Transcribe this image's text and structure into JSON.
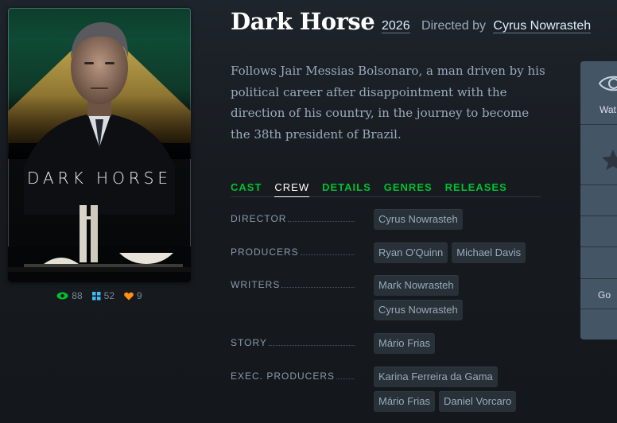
{
  "film": {
    "title": "Dark Horse",
    "year": "2026",
    "directed_by_label": "Directed by",
    "director": "Cyrus Nowrasteh",
    "synopsis": "Follows Jair Messias Bolsonaro, a man driven by his political career after disappointment with the direction of his country, in the journey to become the 38th president of Brazil."
  },
  "poster": {
    "title_text": "DARK HORSE"
  },
  "stats": {
    "watched": "88",
    "lists": "52",
    "likes": "9"
  },
  "tabs": [
    {
      "label": "CAST",
      "active": false
    },
    {
      "label": "CREW",
      "active": true
    },
    {
      "label": "DETAILS",
      "active": false
    },
    {
      "label": "GENRES",
      "active": false
    },
    {
      "label": "RELEASES",
      "active": false
    }
  ],
  "crew": [
    {
      "role": "DIRECTOR",
      "names": [
        "Cyrus Nowrasteh"
      ]
    },
    {
      "role": "PRODUCERS",
      "names": [
        "Ryan O'Quinn",
        "Michael Davis"
      ]
    },
    {
      "role": "WRITERS",
      "names": [
        "Mark Nowrasteh",
        "Cyrus Nowrasteh"
      ]
    },
    {
      "role": "STORY",
      "names": [
        "Mário Frias"
      ]
    },
    {
      "role": "EXEC. PRODUCERS",
      "names": [
        "Karina Ferreira da Gama",
        "Mário Frias",
        "Daniel Vorcaro"
      ]
    }
  ],
  "side_panel": {
    "watch_label": "Wat",
    "go_label": "Go"
  },
  "colors": {
    "accent_green": "#00c030",
    "stat_eye": "#00c030",
    "stat_lists": "#40bcf4",
    "stat_heart": "#ff9010"
  }
}
